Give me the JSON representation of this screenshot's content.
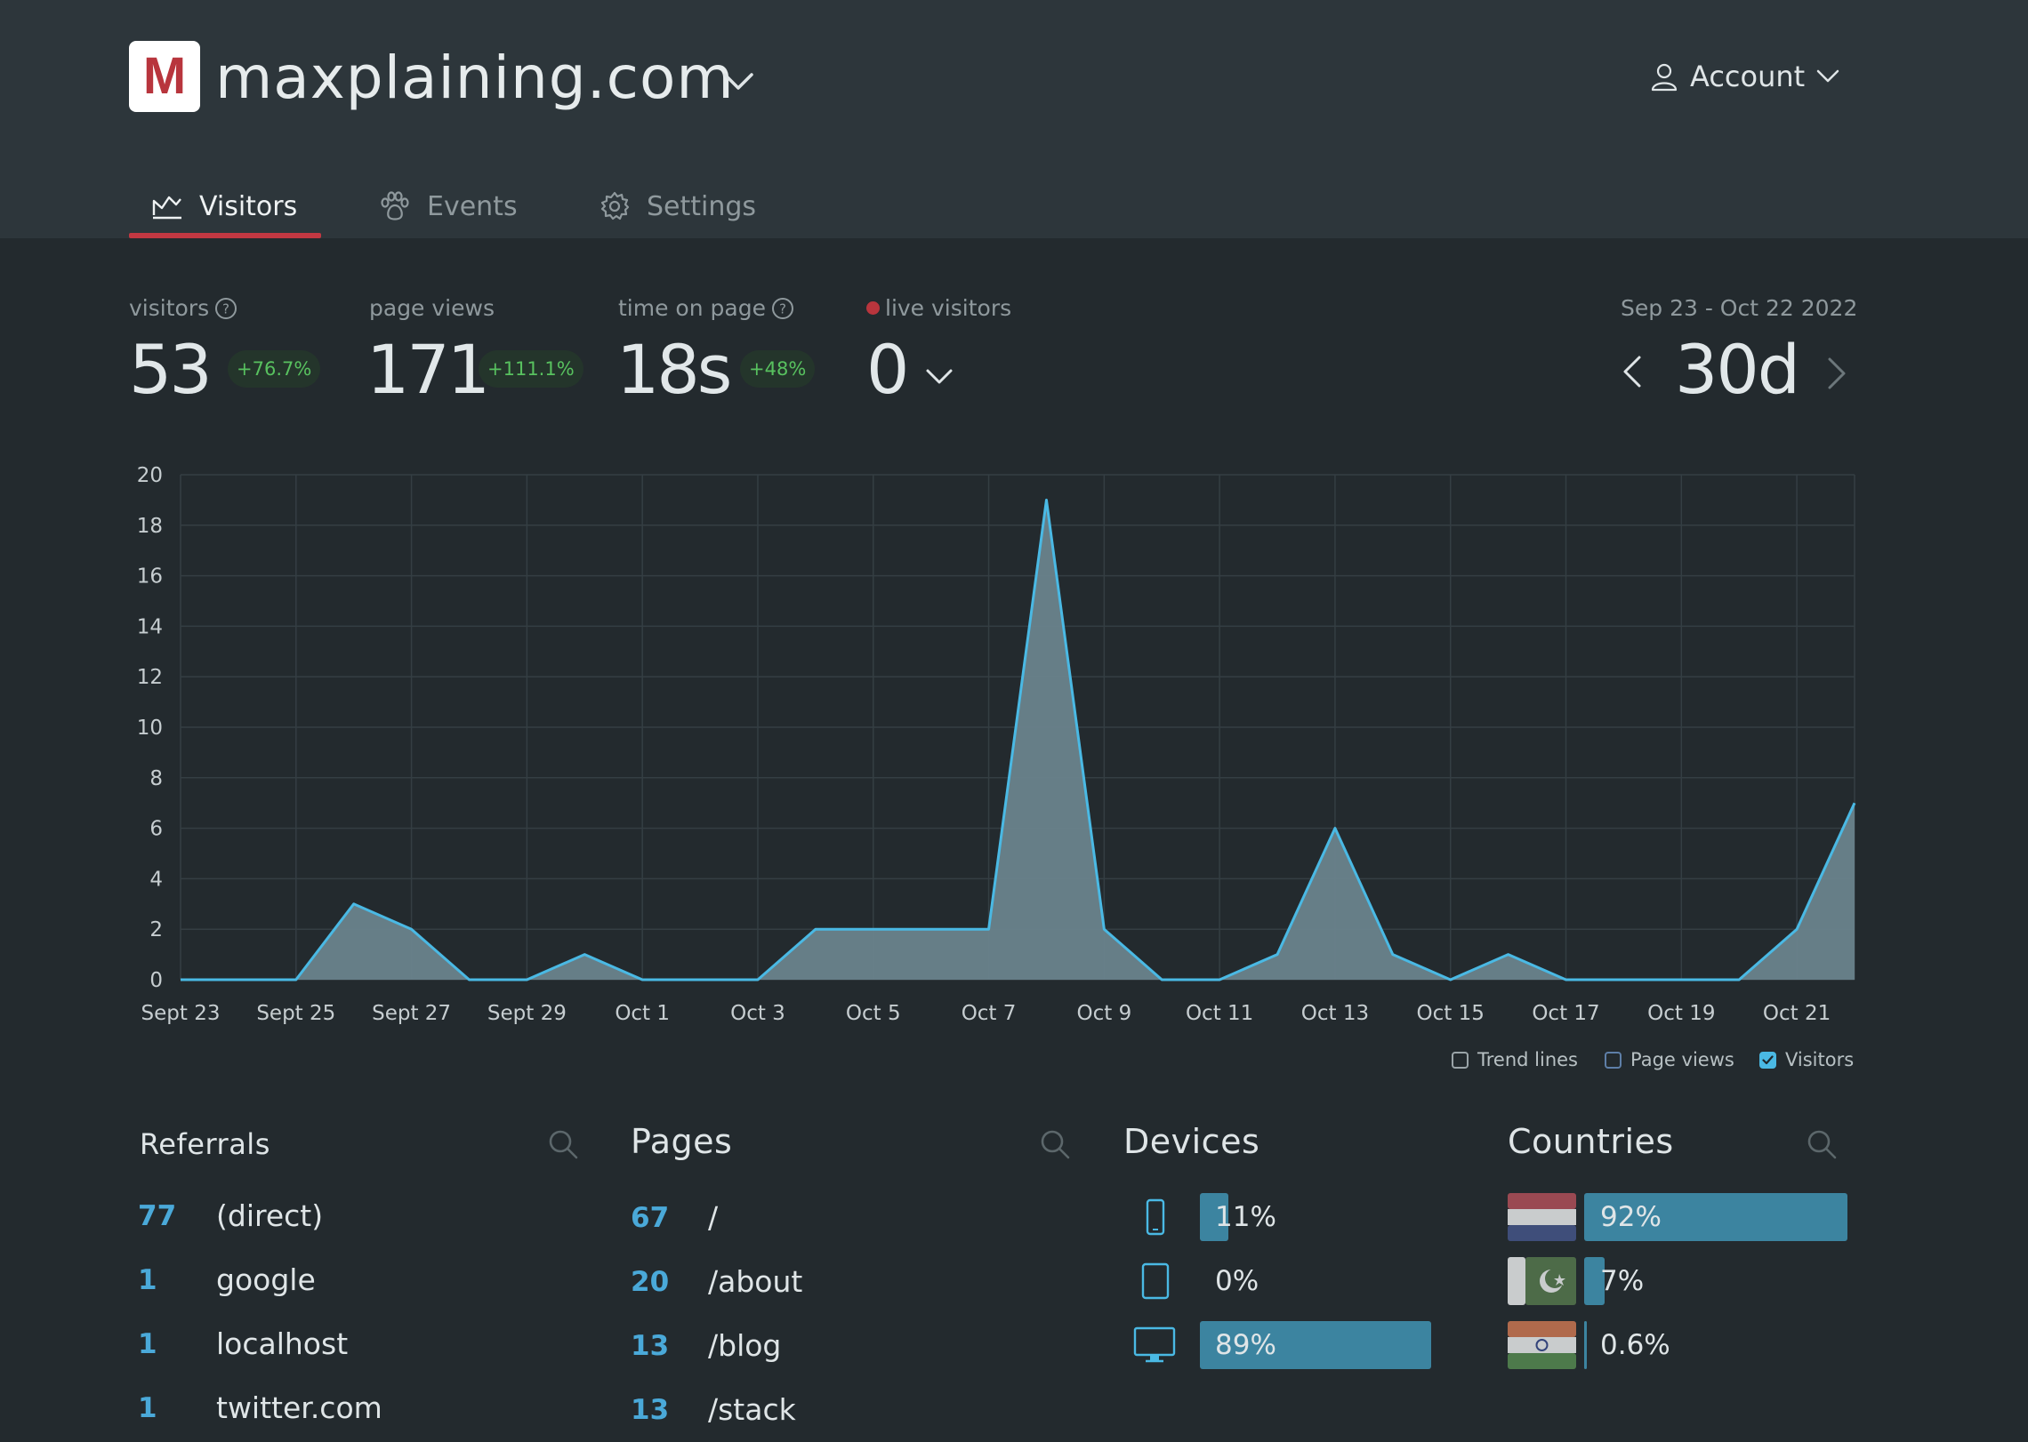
{
  "header": {
    "logo_letter": "M",
    "site_name": "maxplaining.com",
    "account_label": "Account"
  },
  "tabs": [
    {
      "label": "Visitors",
      "icon": "chart-icon",
      "active": true
    },
    {
      "label": "Events",
      "icon": "paw-icon",
      "active": false
    },
    {
      "label": "Settings",
      "icon": "gear-icon",
      "active": false
    }
  ],
  "stats": {
    "visitors": {
      "label": "visitors",
      "value": "53",
      "change": "+76.7%"
    },
    "page_views": {
      "label": "page views",
      "value": "171",
      "change": "+111.1%"
    },
    "time_on_page": {
      "label": "time on page",
      "value": "18s",
      "change": "+48%"
    },
    "live_visitors": {
      "label": "live visitors",
      "value": "0"
    }
  },
  "period": {
    "range": "Sep 23 - Oct 22 2022",
    "label": "30d"
  },
  "colors": {
    "accent": "#c23842",
    "series_line": "#4ab9e4",
    "series_fill": "#6a838c",
    "positive": "#58c15f"
  },
  "chart_data": {
    "type": "area",
    "x": [
      "Sept 23",
      "Sept 24",
      "Sept 25",
      "Sept 26",
      "Sept 27",
      "Sept 28",
      "Sept 29",
      "Sept 30",
      "Oct 1",
      "Oct 2",
      "Oct 3",
      "Oct 4",
      "Oct 5",
      "Oct 6",
      "Oct 7",
      "Oct 8",
      "Oct 9",
      "Oct 10",
      "Oct 11",
      "Oct 12",
      "Oct 13",
      "Oct 14",
      "Oct 15",
      "Oct 16",
      "Oct 17",
      "Oct 18",
      "Oct 19",
      "Oct 20",
      "Oct 21",
      "Oct 22"
    ],
    "x_tick_labels": [
      "Sept 23",
      "Sept 25",
      "Sept 27",
      "Sept 29",
      "Oct 1",
      "Oct 3",
      "Oct 5",
      "Oct 7",
      "Oct 9",
      "Oct 11",
      "Oct 13",
      "Oct 15",
      "Oct 17",
      "Oct 19",
      "Oct 21"
    ],
    "series": [
      {
        "values": [
          0,
          0,
          0,
          3,
          2,
          0,
          0,
          1,
          0,
          0,
          0,
          2,
          2,
          2,
          2,
          19,
          2,
          0,
          0,
          1,
          6,
          1,
          0,
          1,
          0,
          0,
          0,
          0,
          2,
          7
        ]
      }
    ],
    "y_ticks": [
      0,
      2,
      4,
      6,
      8,
      10,
      12,
      14,
      16,
      18,
      20
    ],
    "ylim": [
      0,
      20
    ],
    "grid": true
  },
  "legend": [
    {
      "label": "Trend lines",
      "checked": false
    },
    {
      "label": "Page views",
      "checked": false
    },
    {
      "label": "Visitors",
      "checked": true
    }
  ],
  "referrals": {
    "title": "Referrals",
    "rows": [
      {
        "count": "77",
        "name": "(direct)"
      },
      {
        "count": "1",
        "name": "google"
      },
      {
        "count": "1",
        "name": "localhost"
      },
      {
        "count": "1",
        "name": "twitter.com"
      }
    ]
  },
  "pages": {
    "title": "Pages",
    "rows": [
      {
        "count": "67",
        "path": "/"
      },
      {
        "count": "20",
        "path": "/about"
      },
      {
        "count": "13",
        "path": "/blog"
      },
      {
        "count": "13",
        "path": "/stack"
      }
    ]
  },
  "devices": {
    "title": "Devices",
    "rows": [
      {
        "icon": "mobile-icon",
        "percent": "11%",
        "share": 0.11
      },
      {
        "icon": "tablet-icon",
        "percent": "0%",
        "share": 0.0
      },
      {
        "icon": "desktop-icon",
        "percent": "89%",
        "share": 0.89
      }
    ]
  },
  "countries": {
    "title": "Countries",
    "rows": [
      {
        "flag": "netherlands-flag-icon",
        "percent": "92%",
        "share": 0.92
      },
      {
        "flag": "pakistan-flag-icon",
        "percent": "7%",
        "share": 0.07
      },
      {
        "flag": "india-flag-icon",
        "percent": "0.6%",
        "share": 0.006
      }
    ]
  }
}
